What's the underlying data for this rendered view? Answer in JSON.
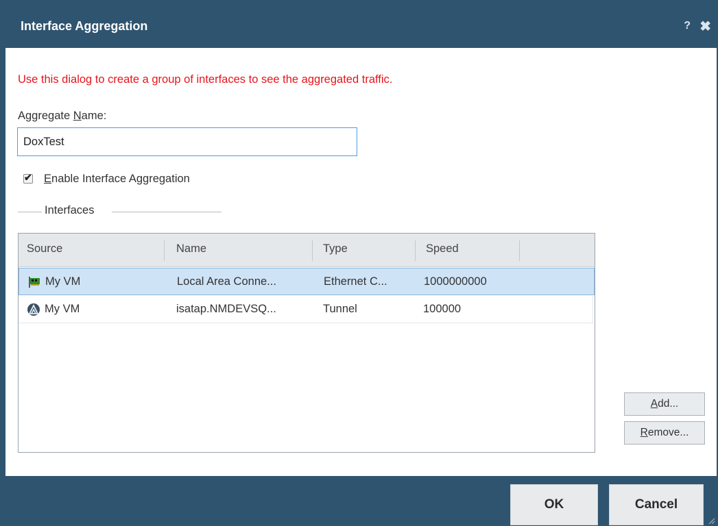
{
  "dialog": {
    "title": "Interface Aggregation",
    "help_glyph": "?",
    "close_glyph": "✖"
  },
  "instructions": "Use this dialog to create a group of interfaces to see the aggregated traffic.",
  "aggregate_name": {
    "label_pre": "Aggregate ",
    "label_accel": "N",
    "label_post": "ame:",
    "value": "DoxTest"
  },
  "enable": {
    "label_accel": "E",
    "label_rest": "nable Interface Aggregation",
    "checked": true
  },
  "interfaces_group": {
    "label": "Interfaces"
  },
  "table": {
    "columns": [
      "Source",
      "Name",
      "Type",
      "Speed"
    ],
    "rows": [
      {
        "source": "My VM",
        "name": "Local Area Conne...",
        "type": "Ethernet C...",
        "speed": "1000000000",
        "icon": "network-card-icon",
        "selected": true
      },
      {
        "source": "My VM",
        "name": "isatap.NMDEVSQ...",
        "type": "Tunnel",
        "speed": "100000",
        "icon": "tunnel-icon",
        "selected": false
      }
    ]
  },
  "side_buttons": {
    "add_accel": "A",
    "add_rest": "dd...",
    "remove_accel": "R",
    "remove_rest": "emove..."
  },
  "footer": {
    "ok_label": "OK",
    "cancel_label": "Cancel"
  },
  "colors": {
    "titlebar": "#2f5470",
    "instructions": "#e8141b",
    "selected_row": "#cfe3f7",
    "input_focus_border": "#4a9ee6"
  }
}
